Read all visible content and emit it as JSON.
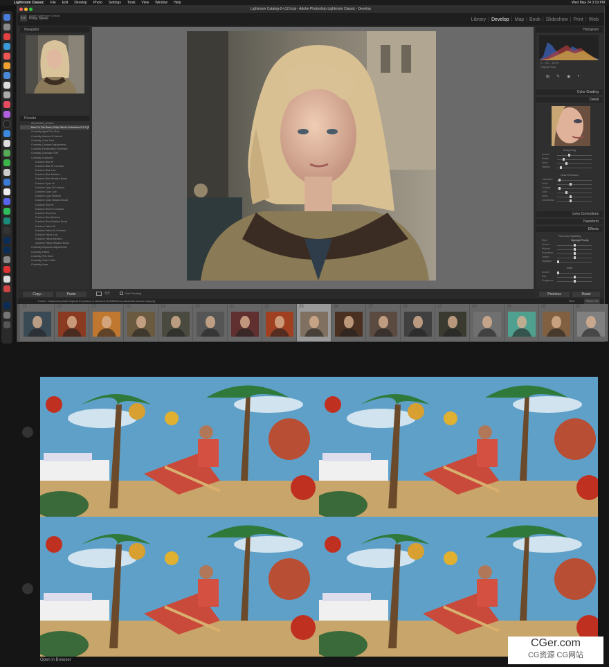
{
  "menubar": {
    "app": "Lightroom Classic",
    "items": [
      "File",
      "Edit",
      "Develop",
      "Photo",
      "Settings",
      "Tools",
      "View",
      "Window",
      "Help"
    ],
    "clock": "Wed May 24  3:19 PM"
  },
  "window": {
    "title": "Lightroom Catalog-2-v12.lrcat - Adobe Photoshop Lightroom Classic - Develop"
  },
  "identity": {
    "brand": "Adobe Lightroom Classic",
    "user": "Philip Steele"
  },
  "modules": [
    "Library",
    "Develop",
    "Map",
    "Book",
    "Slideshow",
    "Print",
    "Web"
  ],
  "left": {
    "navigator": "Navigator",
    "presets": "Presets"
  },
  "presets": [
    {
      "label": "aRunbrdbol_presets",
      "cls": "pitem"
    },
    {
      "label": "Back To The Basic; Philip Steele Collections 2 & 3 (P...",
      "cls": "pitem sel"
    },
    {
      "label": "Contextly Aged Film Sims",
      "cls": "pitem"
    },
    {
      "label": "Contextly Autumn & Harvest",
      "cls": "pitem"
    },
    {
      "label": "Contextly Color Cast",
      "cls": "pitem"
    },
    {
      "label": "Contextly Contrast Adjustments",
      "cls": "pitem"
    },
    {
      "label": "Contextly Desaturated Cinematic",
      "cls": "pitem"
    },
    {
      "label": "Contextly Dramatic HDR",
      "cls": "pitem"
    },
    {
      "label": "Contextly Duotones",
      "cls": "pitem"
    },
    {
      "label": "Duotone Blue Hi",
      "cls": "pitem sub"
    },
    {
      "label": "Duotone Blue Hi Contrast",
      "cls": "pitem sub"
    },
    {
      "label": "Duotone Blue Low",
      "cls": "pitem sub"
    },
    {
      "label": "Duotone Blue Medium",
      "cls": "pitem sub"
    },
    {
      "label": "Duotone Blue Shadow Boost",
      "cls": "pitem sub"
    },
    {
      "label": "Duotone Cyan Hi",
      "cls": "pitem sub"
    },
    {
      "label": "Duotone Cyan Hi Contrast",
      "cls": "pitem sub"
    },
    {
      "label": "Duotone Cyan Low",
      "cls": "pitem sub"
    },
    {
      "label": "Duotone Cyan Medium",
      "cls": "pitem sub"
    },
    {
      "label": "Duotone Cyan Shadow Boost",
      "cls": "pitem sub"
    },
    {
      "label": "Duotone Rust Hi",
      "cls": "pitem sub"
    },
    {
      "label": "Duotone Rust Hi Contrast",
      "cls": "pitem sub"
    },
    {
      "label": "Duotone Rust Low",
      "cls": "pitem sub"
    },
    {
      "label": "Duotone Rust Medium",
      "cls": "pitem sub"
    },
    {
      "label": "Duotone Rust Shadow Boost",
      "cls": "pitem sub"
    },
    {
      "label": "Duotone Yellow Hi",
      "cls": "pitem sub"
    },
    {
      "label": "Duotone Yellow Hi Contrast",
      "cls": "pitem sub"
    },
    {
      "label": "Duotone Yellow Low",
      "cls": "pitem sub"
    },
    {
      "label": "Duotone Yellow Medium",
      "cls": "pitem sub"
    },
    {
      "label": "Duotone Yellow Shadow Boost",
      "cls": "pitem sub"
    },
    {
      "label": "Contextly Exposure Adjustments",
      "cls": "pitem"
    },
    {
      "label": "Contextly Faded",
      "cls": "pitem"
    },
    {
      "label": "Contextly Film Sims",
      "cls": "pitem"
    },
    {
      "label": "Contextly Green Edits",
      "cls": "pitem"
    },
    {
      "label": "Contextly Haze",
      "cls": "pitem"
    }
  ],
  "right": {
    "histogram": "Histogram",
    "original_photo": "Original Photo",
    "readout": "f/ --   ISO --   28.5%",
    "color_grading": "Color Grading",
    "detail": "Detail",
    "sharpening": "Sharpening",
    "noise_reduction": "Noise Reduction",
    "lens": "Lens Corrections",
    "transform": "Transform",
    "effects": "Effects",
    "vignetting": "Post-Crop Vignetting",
    "style": "Style",
    "style_val": "Highlight Priority",
    "grain": "Grain"
  },
  "sliders": {
    "s1": "Amount",
    "s2": "Radius",
    "s3": "Detail",
    "s4": "Masking",
    "n1": "Luminance",
    "n2": "Detail",
    "n3": "Contrast",
    "n4": "Color",
    "n5": "Detail",
    "n6": "Smoothness",
    "v1": "Amount",
    "v2": "Midpoint",
    "v3": "Roundness",
    "v4": "Feather",
    "v5": "Highlights",
    "g1": "Amount",
    "g2": "Size",
    "g3": "Roughness"
  },
  "buttons": {
    "copy": "Copy...",
    "paste": "Paste",
    "previous": "Previous",
    "reset": "Reset",
    "soft_proof": "Soft Proofing"
  },
  "filmstrip": {
    "header": "Folder : Midjourney Auto Imports     31 photos /1 selected /20230524-mj-ukrainian-woman-city.png",
    "filter": "Filter :",
    "filter_val": "Filters Off",
    "nums": [
      "15",
      "16",
      "17",
      "18",
      "19",
      "20",
      "21",
      "22",
      "23",
      "24",
      "25",
      "26",
      "27",
      "28",
      "29",
      "30",
      "31"
    ],
    "selected_index": 8
  },
  "lower": {
    "open_browser": "Open in Browser"
  },
  "watermark": {
    "line1": "CGer.com",
    "line2": "CG资源 CG网站"
  }
}
